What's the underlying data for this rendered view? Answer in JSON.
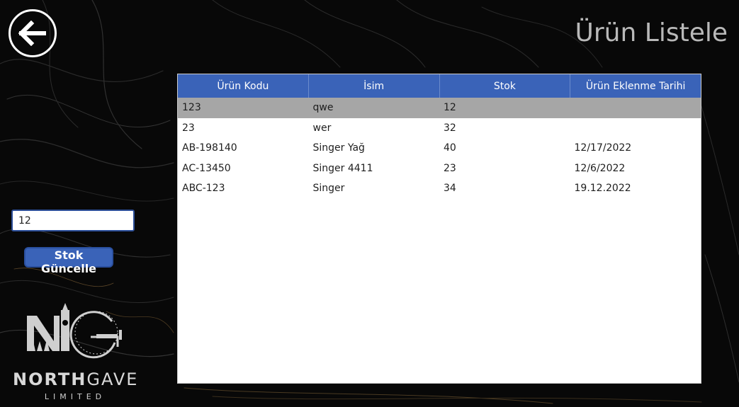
{
  "header": {
    "title": "Ürün Listele",
    "back_icon": "arrow-left-icon"
  },
  "table": {
    "columns": [
      "Ürün Kodu",
      "İsim",
      "Stok",
      "Ürün Eklenme Tarihi"
    ],
    "rows": [
      [
        "123",
        "qwe",
        "12",
        ""
      ],
      [
        "23",
        "wer",
        "32",
        ""
      ],
      [
        "AB-198140",
        "Singer Yağ",
        "40",
        "12/17/2022"
      ],
      [
        "AC-13450",
        "Singer 4411",
        "23",
        "12/6/2022"
      ],
      [
        "ABC-123",
        "Singer",
        "34",
        "19.12.2022"
      ]
    ],
    "selected_row": 0
  },
  "stock_form": {
    "value": "12",
    "button_label": "Stok Güncelle"
  },
  "logo": {
    "name_bold": "NORTH",
    "name_light": "GAVE",
    "sub": "LIMITED"
  },
  "colors": {
    "accent": "#3a63b8",
    "selected_row": "#a6a6a6",
    "title": "#b9b9b9"
  }
}
